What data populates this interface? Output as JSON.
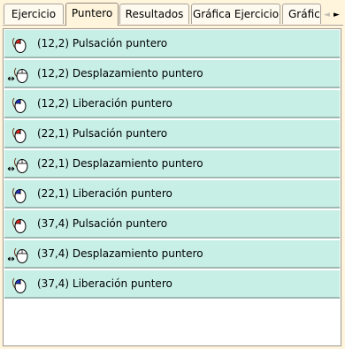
{
  "tabs": [
    {
      "label": "Ejercicio"
    },
    {
      "label": "Puntero",
      "active": true
    },
    {
      "label": "Resultados"
    },
    {
      "label": "Gráfica Ejercicio"
    },
    {
      "label": "Gráfic"
    }
  ],
  "tab_arrows": {
    "left": "◄",
    "right": "►"
  },
  "events": [
    {
      "label": "(12,2) Pulsación puntero",
      "icon": "mouse-press-red-icon"
    },
    {
      "label": "(12,2) Desplazamiento puntero",
      "icon": "mouse-move-icon"
    },
    {
      "label": "(12,2) Liberación puntero",
      "icon": "mouse-release-blue-icon"
    },
    {
      "label": "(22,1) Pulsación puntero",
      "icon": "mouse-press-red-icon"
    },
    {
      "label": "(22,1) Desplazamiento puntero",
      "icon": "mouse-move-icon"
    },
    {
      "label": "(22,1) Liberación puntero",
      "icon": "mouse-release-blue-icon"
    },
    {
      "label": "(37,4) Pulsación puntero",
      "icon": "mouse-press-red-icon"
    },
    {
      "label": "(37,4) Desplazamiento puntero",
      "icon": "mouse-move-icon"
    },
    {
      "label": "(37,4) Liberación puntero",
      "icon": "mouse-release-blue-icon"
    }
  ],
  "colors": {
    "row_bg": "#c7efe6",
    "accent_press": "#e0281c",
    "accent_release": "#2233cc",
    "window_bg": "#fff4dc"
  }
}
